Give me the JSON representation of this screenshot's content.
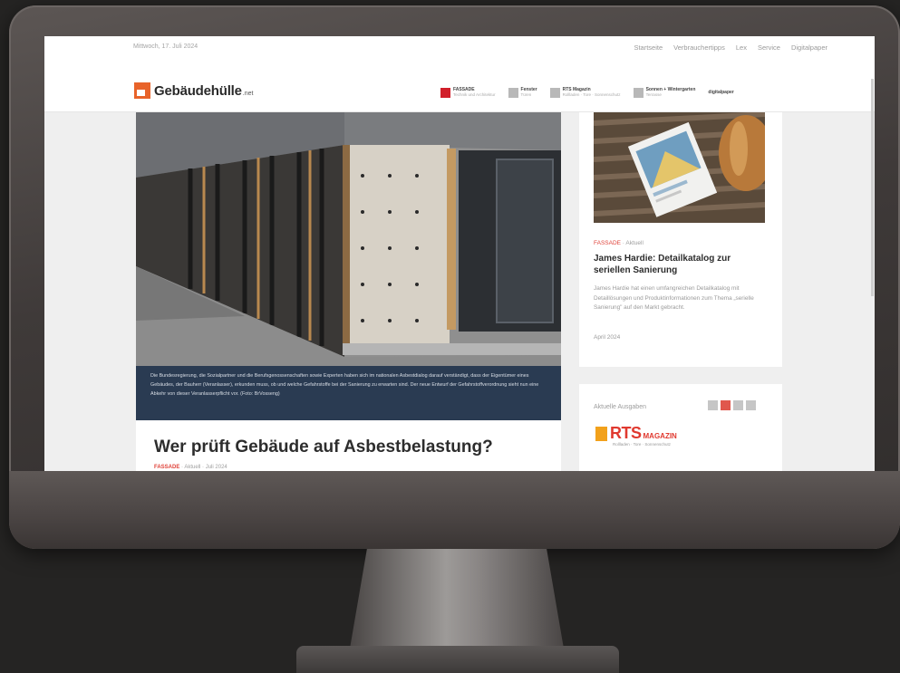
{
  "topbar": {
    "date": "Mittwoch, 17. Juli 2024",
    "nav": [
      "Startseite",
      "Verbrauchertipps",
      "Lex",
      "Service",
      "Digitalpaper"
    ]
  },
  "header": {
    "logo_text": "Gebäudehülle",
    "logo_suffix": ".net",
    "partners": [
      {
        "name": "FASSADE",
        "sub": "Technik und Architektur",
        "color": "#d11f2a"
      },
      {
        "name": "Fenster",
        "sub": "Türen",
        "color": "#b8b8b8"
      },
      {
        "name": "RTS Magazin",
        "sub": "Rollladen · Tore · Sonnenschutz",
        "color": "#b8b8b8"
      },
      {
        "name": "Sonnen + Wintergarten",
        "sub": "Terrasse",
        "color": "#b8b8b8"
      },
      {
        "name": "digitalpaper",
        "sub": "",
        "color": "#b8b8b8"
      }
    ]
  },
  "hero": {
    "caption": "Die Bundesregierung, die Sozialpartner und die Berufsgenossenschaften sowie Experten haben sich im nationalen Asbestdialog darauf verständigt, dass der Eigentümer eines Gebäudes, der Bauherr (Veranlasser), erkunden muss, ob und welche Gefahrstoffe bei der Sanierung zu erwarten sind. Der neue Entwurf der Gefahrstoffverordnung sieht nun eine Abkehr von dieser Veranlasserpflicht vor. (Foto: BrVosseng)"
  },
  "article": {
    "headline": "Wer prüft Gebäude auf Asbestbelastung?",
    "category": "FASSADE",
    "section": "Aktuell",
    "date": "Juli 2024"
  },
  "sidebar": {
    "kicker_category": "FASSADE",
    "kicker_section": "Aktuell",
    "title": "James Hardie: Detailkatalog zur seriellen Sanierung",
    "text": "James Hardie hat einen umfangreichen Detailkatalog mit Detaillösungen und Produktinformationen zum Thema „serielle Sanierung\" auf den Markt gebracht.",
    "date": "April 2024"
  },
  "issues": {
    "label": "Aktuelle Ausgaben",
    "magazine": "RTS",
    "magazine_word": "MAGAZIN",
    "magazine_sub": "Rollladen · Tore · Sonnenschutz",
    "active_index": 1,
    "count": 4
  },
  "colors": {
    "accent": "#e0443b",
    "caption_bg": "#2a3b52",
    "logo_orange": "#e8632a"
  }
}
